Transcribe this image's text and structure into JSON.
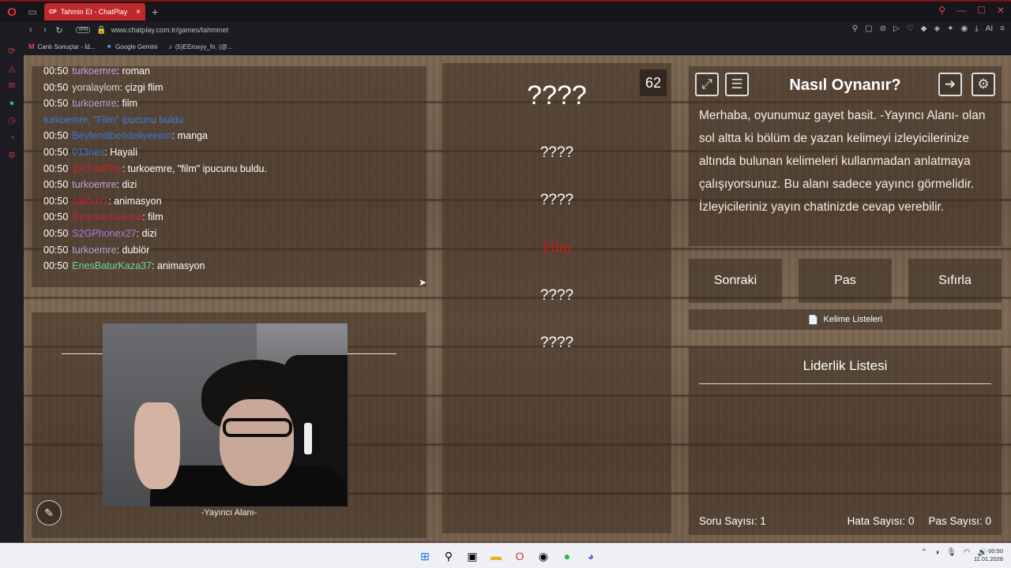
{
  "browser": {
    "tab_title": "Tahmin Et - ChatPlay",
    "tab_badge": "CP",
    "url": "www.chatplay.com.tr/games/tahminet",
    "vpn_label": "VPN",
    "ai_label": "AI",
    "bookmarks": [
      {
        "icon": "m-icon",
        "label": "Canlı Sonuçlar - İd..."
      },
      {
        "icon": "gemini-icon",
        "label": "Google Gemini"
      },
      {
        "icon": "tiktok-icon",
        "label": "(5)EEroxyy_fn. (@..."
      }
    ]
  },
  "chat": {
    "messages": [
      {
        "time": "00:50",
        "user": "turkoemre",
        "user_color": "#b9a6e0",
        "text": ": roman"
      },
      {
        "time": "00:50",
        "user": "yoralaylom",
        "user_color": "#d6d6d6",
        "text": ": çizgi flim"
      },
      {
        "time": "00:50",
        "user": "turkoemre",
        "user_color": "#b9a6e0",
        "text": ": film"
      },
      {
        "time": "",
        "user": "turkoemre, \"Film\" ipucunu buldu.",
        "user_color": "#3b7ad8",
        "text": ""
      },
      {
        "time": "00:50",
        "user": "Beyfendibendeliyeeem",
        "user_color": "#3a76d0",
        "text": ": manga"
      },
      {
        "time": "00:50",
        "user": "013nes",
        "user_color": "#3a76d0",
        "text": ": Hayali"
      },
      {
        "time": "00:50",
        "user": "@ChatPlay",
        "user_color": "#c2262e",
        "text": ": turkoemre, \"film\" ipucunu buldu."
      },
      {
        "time": "00:50",
        "user": "turkoemre",
        "user_color": "#b9a6e0",
        "text": ": dizi"
      },
      {
        "time": "00:50",
        "user": "salihuz1",
        "user_color": "#c2262e",
        "text": ": animasyon"
      },
      {
        "time": "00:50",
        "user": "RyomanSukuna",
        "user_color": "#c2262e",
        "text": ": film"
      },
      {
        "time": "00:50",
        "user": "S2GPhonex27",
        "user_color": "#b07ad8",
        "text": ": dizi"
      },
      {
        "time": "00:50",
        "user": "turkoemre",
        "user_color": "#b9a6e0",
        "text": ": dublör"
      },
      {
        "time": "00:50",
        "user": "EnesBaturKaza37",
        "user_color": "#6cd6a0",
        "text": ": animasyon"
      }
    ]
  },
  "streamer": {
    "label": "-Yayıncı Alanı-"
  },
  "words": {
    "counter": "62",
    "items": [
      {
        "text": "????",
        "found": false,
        "big": true
      },
      {
        "text": "????",
        "found": false,
        "big": false
      },
      {
        "text": "????",
        "found": false,
        "big": false
      },
      {
        "text": "Film",
        "found": true,
        "big": false
      },
      {
        "text": "????",
        "found": false,
        "big": false
      },
      {
        "text": "????",
        "found": false,
        "big": false
      }
    ]
  },
  "howto": {
    "title": "Nasıl Oynanır?",
    "text": "Merhaba, oyunumuz gayet basit. -Yayıncı Alanı- olan sol altta ki bölüm de yazan kelimeyi izleyicilerinize altında bulunan kelimeleri kullanmadan anlatmaya çalışıyorsunuz. Bu alanı sadece yayıncı görmelidir. İzleyicileriniz yayın chatinizde cevap verebilir."
  },
  "actions": {
    "next": "Sonraki",
    "pass": "Pas",
    "reset": "Sıfırla"
  },
  "word_lists": {
    "label": "Kelime Listeleri"
  },
  "leaderboard": {
    "title": "Liderlik Listesi",
    "question_count": "Soru Sayısı: 1",
    "error_count": "Hata Sayısı: 0",
    "pass_count": "Pas Sayısı: 0"
  },
  "taskbar": {
    "time": "00:50",
    "date": "11.01.2026"
  }
}
